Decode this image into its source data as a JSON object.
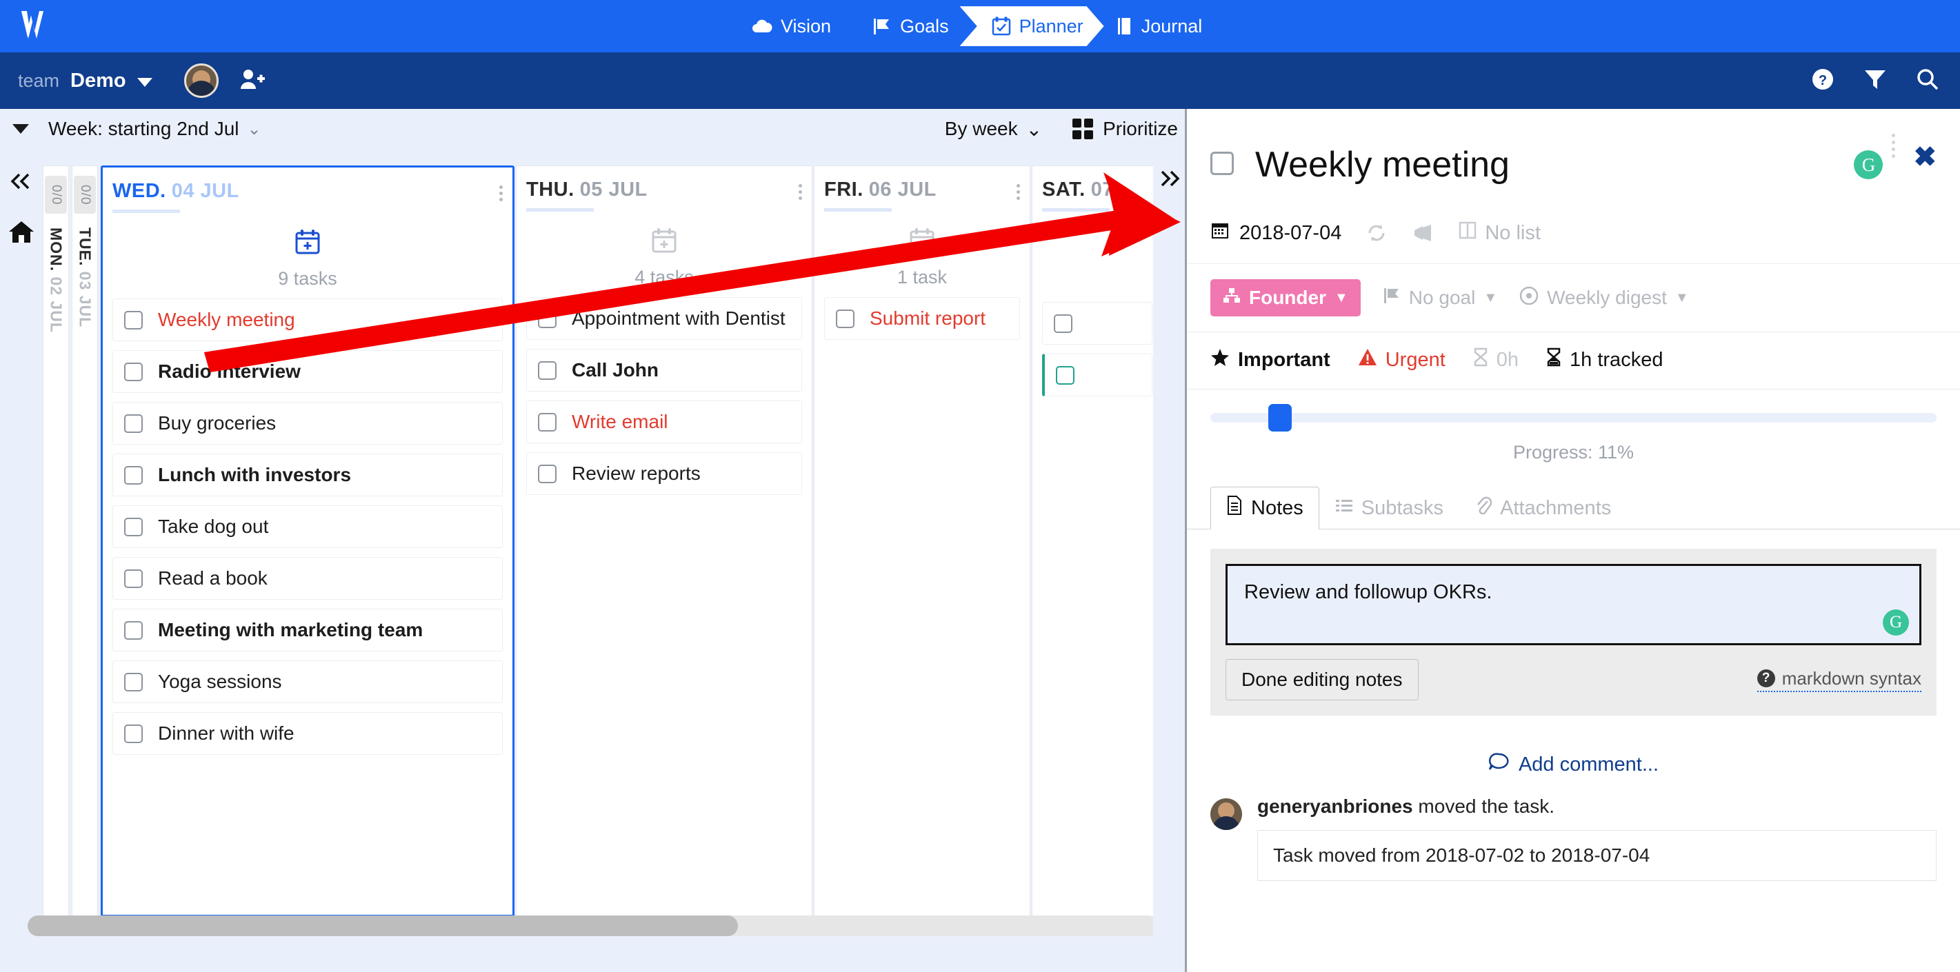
{
  "topnav": {
    "logo": "w-logo",
    "tabs": [
      {
        "label": "Vision",
        "icon": "cloud-icon",
        "active": false
      },
      {
        "label": "Goals",
        "icon": "flag-icon",
        "active": false
      },
      {
        "label": "Planner",
        "icon": "calendar-check-icon",
        "active": true
      },
      {
        "label": "Journal",
        "icon": "book-icon",
        "active": false
      }
    ]
  },
  "subbar": {
    "team_label": "team",
    "team_name": "Demo",
    "avatar": "user-avatar",
    "add_user_icon": "add-user-icon",
    "right_icons": [
      "help-icon",
      "filter-icon",
      "search-icon"
    ]
  },
  "weekbar": {
    "collapse_icon": "triangle-down-icon",
    "week_text": "Week: starting 2nd Jul",
    "week_chevron": "chevron-down-icon",
    "by_week": "By week",
    "prioritize": "Prioritize"
  },
  "leftrail": {
    "collapse_label": "«",
    "home_icon": "home-icon"
  },
  "board": {
    "collapsed_days": [
      {
        "badge": "0/0",
        "dow": "MON.",
        "date": "02 JUL"
      },
      {
        "badge": "0/0",
        "dow": "TUE.",
        "date": "03 JUL"
      }
    ],
    "columns": [
      {
        "dow": "WED.",
        "date": "04 JUL",
        "active": true,
        "add_icon": "calendar-plus-icon",
        "count_label": "9 tasks",
        "tasks": [
          {
            "label": "Weekly meeting",
            "style": "red"
          },
          {
            "label": "Radio interview",
            "style": "bold"
          },
          {
            "label": "Buy groceries",
            "style": "normal"
          },
          {
            "label": "Lunch with investors",
            "style": "bold"
          },
          {
            "label": "Take dog out",
            "style": "normal"
          },
          {
            "label": "Read a book",
            "style": "normal"
          },
          {
            "label": "Meeting with marketing team",
            "style": "bold"
          },
          {
            "label": "Yoga sessions",
            "style": "normal"
          },
          {
            "label": "Dinner with wife",
            "style": "normal"
          }
        ]
      },
      {
        "dow": "THU.",
        "date": "05 JUL",
        "active": false,
        "add_icon": "calendar-plus-icon",
        "count_label": "4 tasks",
        "tasks": [
          {
            "label": "Appointment with Dentist",
            "style": "normal"
          },
          {
            "label": "Call John",
            "style": "bold"
          },
          {
            "label": "Write email",
            "style": "red"
          },
          {
            "label": "Review reports",
            "style": "normal"
          }
        ]
      },
      {
        "dow": "FRI.",
        "date": "06 JUL",
        "active": false,
        "add_icon": "calendar-plus-icon",
        "count_label": "1 task",
        "tasks": [
          {
            "label": "Submit report",
            "style": "red"
          }
        ]
      },
      {
        "dow": "SAT.",
        "date": "07",
        "active": false,
        "add_icon": "calendar-plus-icon",
        "count_label": "",
        "tasks": [
          {
            "label": "",
            "style": "red"
          },
          {
            "label": "",
            "style": "red"
          }
        ]
      }
    ],
    "collapse_right_icon": "»"
  },
  "panel": {
    "checkbox": "task-complete-checkbox",
    "title": "Weekly meeting",
    "grammarly_glyph": "G",
    "close_glyph": "✖",
    "meta": {
      "date": "2018-07-04",
      "repeat_icon": "repeat-icon",
      "notify_icon": "megaphone-icon",
      "list_label": "No list",
      "list_icon": "columns-icon"
    },
    "tags": {
      "role": "Founder",
      "role_icon": "sitemap-icon",
      "goal": "No goal",
      "goal_icon": "flag-icon",
      "digest": "Weekly digest",
      "digest_icon": "target-icon"
    },
    "flags": {
      "important": "Important",
      "important_icon": "star-icon",
      "urgent": "Urgent",
      "urgent_icon": "warning-icon",
      "estimate": "0h",
      "estimate_icon": "hourglass-empty-icon",
      "tracked": "1h tracked",
      "tracked_icon": "hourglass-full-icon"
    },
    "progress": {
      "label": "Progress: 11%",
      "percent": 11
    },
    "tabs": [
      {
        "label": "Notes",
        "icon": "document-icon",
        "active": true
      },
      {
        "label": "Subtasks",
        "icon": "list-icon",
        "active": false
      },
      {
        "label": "Attachments",
        "icon": "paperclip-icon",
        "active": false
      }
    ],
    "notes": {
      "content": "Review and followup OKRs.",
      "grammarly_glyph": "G",
      "done_button": "Done editing notes",
      "markdown_link": "markdown syntax",
      "markdown_icon": "question-icon"
    },
    "comments": {
      "add_label": "Add comment...",
      "add_icon": "comment-icon",
      "activity": [
        {
          "author": "generyanbriones",
          "action": "moved the task.",
          "detail": "Task moved from 2018-07-02 to 2018-07-04",
          "avatar": "user-avatar"
        }
      ]
    }
  },
  "colors": {
    "brand_blue": "#1a66f0",
    "dark_blue": "#103d8c",
    "board_bg": "#eaf0fb",
    "accent_red": "#e23b2e",
    "pill_pink": "#f177b0",
    "grammarly_green": "#3ac49a",
    "arrow_red": "#f20000"
  }
}
